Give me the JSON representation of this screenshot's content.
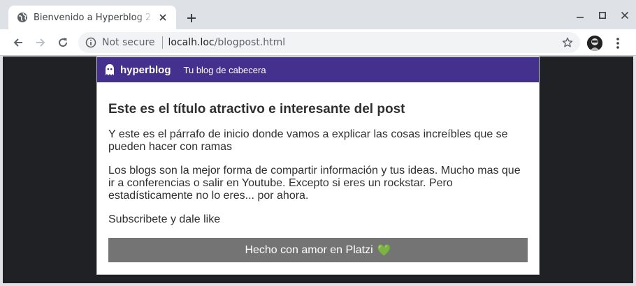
{
  "browser": {
    "tab_title": "Bienvenido a Hyperblog 2.0",
    "security_label": "Not secure",
    "url_host": "localh.loc",
    "url_path": "/blogpost.html",
    "icons": {
      "favicon": "globe-icon",
      "tab_close": "close-icon",
      "new_tab": "plus-icon",
      "back": "arrow-left-icon",
      "forward": "arrow-right-icon",
      "reload": "reload-icon",
      "info": "info-icon",
      "bookmark": "star-icon",
      "profile": "avatar",
      "menu": "kebab-menu-icon",
      "minimize": "minimize-icon",
      "maximize": "maximize-icon",
      "close_window": "close-icon"
    }
  },
  "site": {
    "name": "hyperblog",
    "tagline": "Tu blog de cabecera",
    "header_color": "#44318d",
    "post_title": "Este es el título atractivo e interesante del post",
    "paragraphs": [
      "Y este es el párrafo de inicio donde vamos a explicar las cosas increíbles que se pueden hacer con ramas",
      "Los blogs son la mejor forma de compartir información y tus ideas. Mucho mas que ir a conferencias o salir en Youtube. Excepto si eres un rockstar. Pero estadísticamente no lo eres... por ahora.",
      "Subscribete y dale like"
    ],
    "footer_text": "Hecho con amor en Platzi",
    "footer_emoji": "💚",
    "footer_color": "#747474"
  }
}
